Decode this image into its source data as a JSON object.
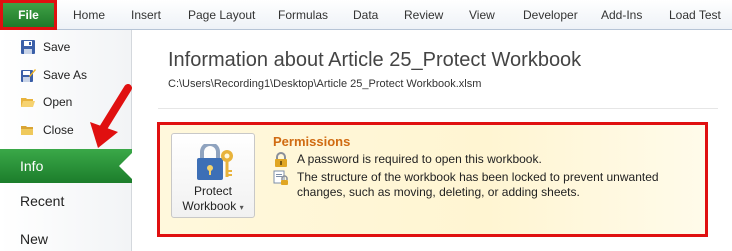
{
  "ribbon": {
    "file_label": "File",
    "tabs": [
      "Home",
      "Insert",
      "Page Layout",
      "Formulas",
      "Data",
      "Review",
      "View",
      "Developer",
      "Add-Ins",
      "Load Test"
    ]
  },
  "backstage": {
    "commands": {
      "save": "Save",
      "save_as": "Save As",
      "open": "Open",
      "close": "Close"
    },
    "info": "Info",
    "recent": "Recent",
    "new": "New"
  },
  "main": {
    "title": "Information about Article 25_Protect Workbook",
    "path": "C:\\Users\\Recording1\\Desktop\\Article 25_Protect Workbook.xlsm"
  },
  "permissions": {
    "button_line1": "Protect",
    "button_line2": "Workbook",
    "heading": "Permissions",
    "line1": "A password is required to open this workbook.",
    "line2a": "The structure of the workbook has been locked to prevent unwanted",
    "line2b": "changes, such as moving, deleting, or adding sheets."
  },
  "colors": {
    "file_tab": "#2e8b3a",
    "highlight_border": "#e01010",
    "permissions_heading": "#d06b12",
    "info_selected": "#2a9138"
  },
  "icons": [
    "save-icon",
    "save-as-icon",
    "open-folder-icon",
    "close-icon",
    "lock-key-icon",
    "lock-icon",
    "structure-lock-icon"
  ]
}
